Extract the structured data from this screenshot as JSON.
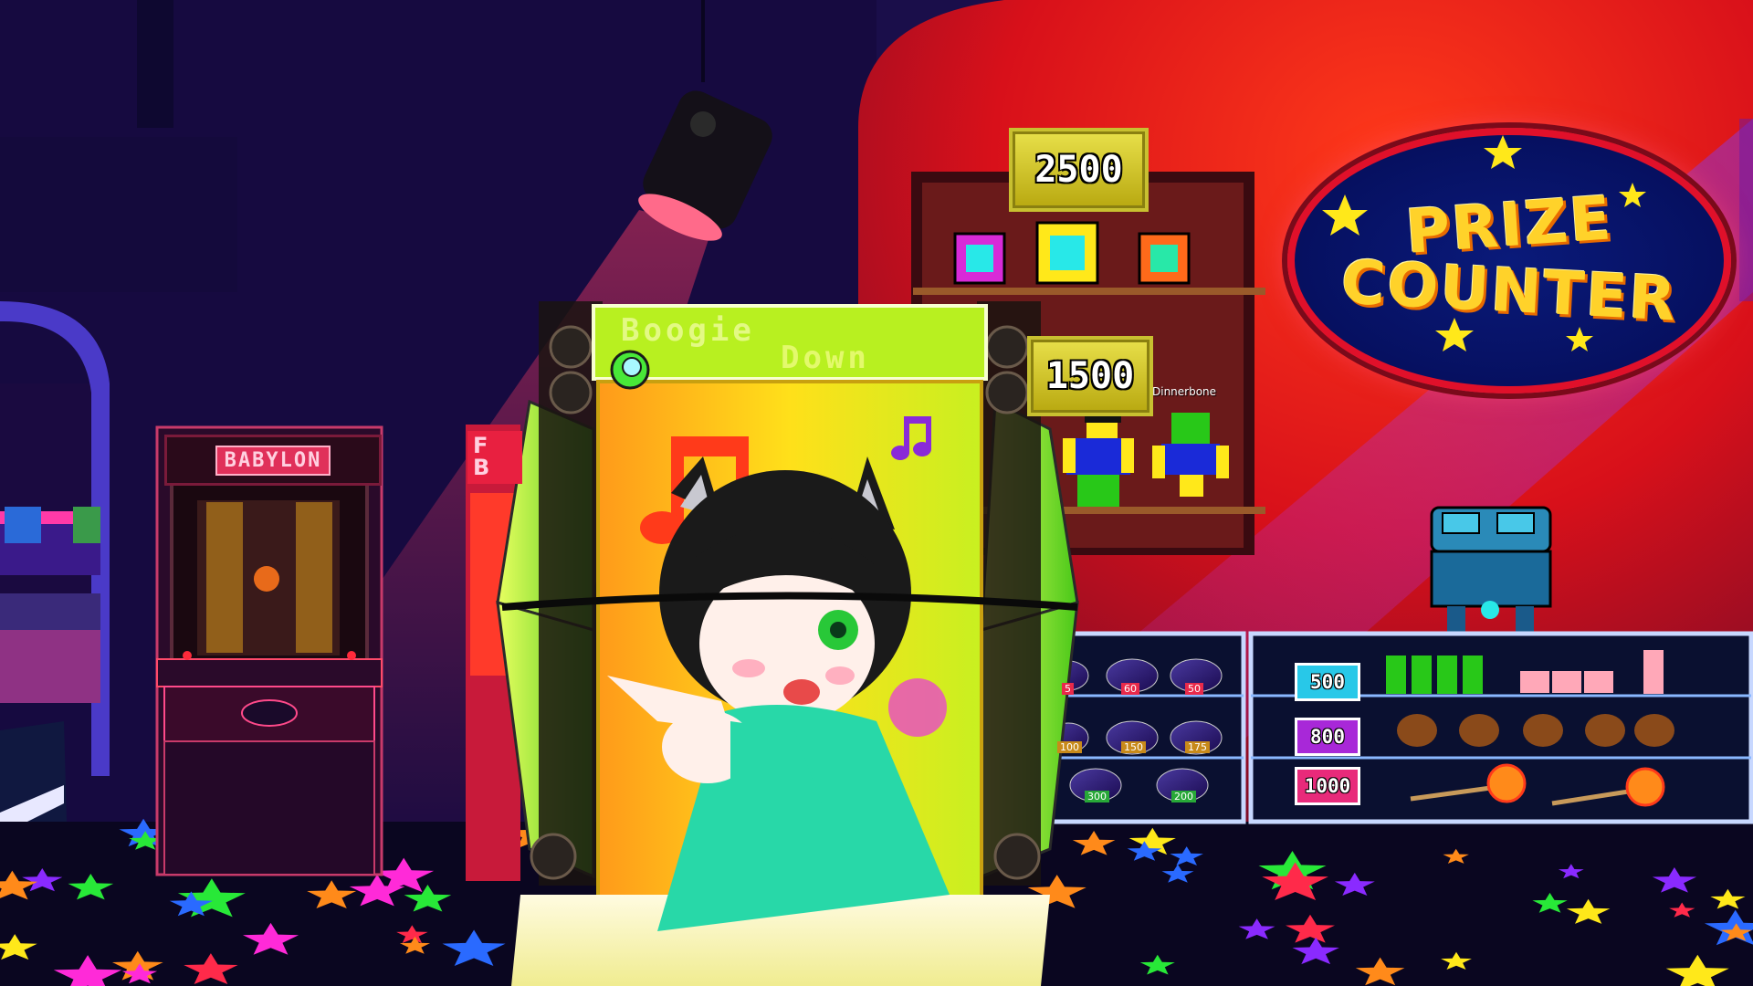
{
  "scene": {
    "type": "arcade prize counter room"
  },
  "prize_counter_sign": {
    "line1": "PRIZE",
    "line2": "COUNTER"
  },
  "wall_shelf": {
    "top_price": "2500",
    "middle_price": "1500",
    "player_name": "Dinnerbone"
  },
  "display_case": {
    "price_tags": [
      "500",
      "800",
      "1000"
    ],
    "basket_tags": [
      "5",
      "60",
      "50",
      "100",
      "150",
      "175",
      "300",
      "200"
    ]
  },
  "arcade_cabinets": {
    "babylon_title": "BABYLON",
    "partial_sign_text": "F\nB"
  },
  "boogie_machine": {
    "title_line1": "Boogie",
    "title_line2": "Down"
  },
  "colors": {
    "floor": "#0a0620",
    "wall_red": "#e01818",
    "sign_gold": "#ffd22a",
    "sign_blue": "#061060",
    "machine_lime": "#a8f020"
  }
}
